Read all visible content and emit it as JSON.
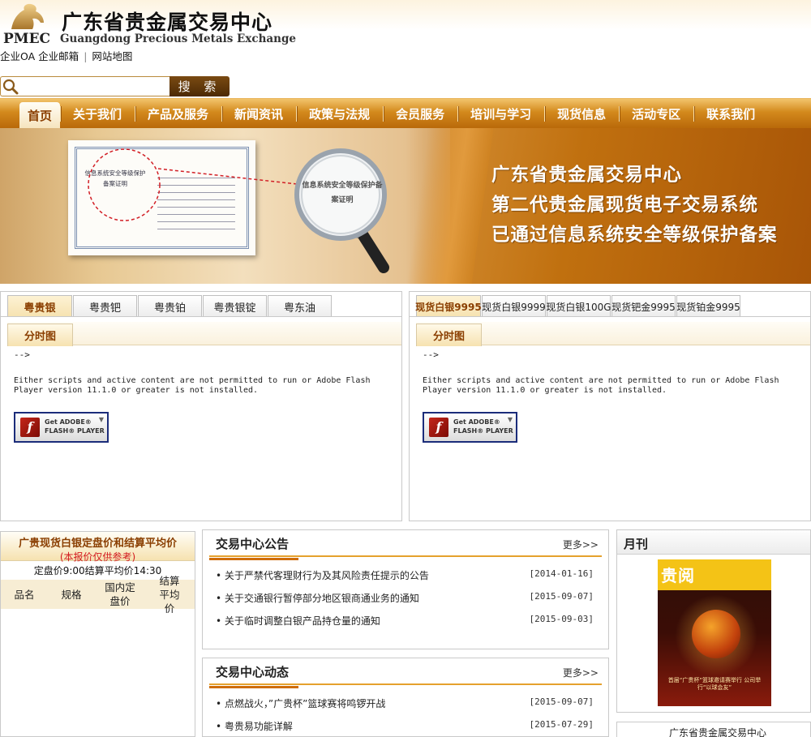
{
  "header": {
    "title_cn": "广东省贵金属交易中心",
    "title_en": "Guangdong Precious Metals Exchange",
    "logo_abbr": "PMEC",
    "links": [
      "企业OA",
      "企业邮箱",
      "网站地图"
    ]
  },
  "search": {
    "placeholder": "",
    "button_label": "搜 索"
  },
  "nav": {
    "items": [
      "首页",
      "关于我们",
      "产品及服务",
      "新闻资讯",
      "政策与法规",
      "会员服务",
      "培训与学习",
      "现货信息",
      "活动专区",
      "联系我们"
    ],
    "active": "首页"
  },
  "banner": {
    "line1": "广东省贵金属交易中心",
    "line2": "第二代贵金属现货电子交易系统",
    "line3": "已通过信息系统安全等级保护备案",
    "cert_title": "信息系统安全等级保护备案证明",
    "magnifier_text": "信息系统安全等级保护备案证明"
  },
  "quote_left": {
    "tabs": [
      "粤贵银",
      "粤贵钯",
      "粤贵铂",
      "粤贵银锭",
      "粤东油"
    ],
    "active_tab": "粤贵银",
    "subtab": "分时图",
    "arrow": "-->",
    "flash_message": "Either scripts and active content are not permitted to run or Adobe Flash Player version 11.1.0 or greater is not installed.",
    "flash_badge_line1": "Get ADOBE®",
    "flash_badge_line2": "FLASH® PLAYER"
  },
  "quote_right": {
    "tabs": [
      "现货白银9995",
      "现货白银9999",
      "现货白银100G",
      "现货钯金9995",
      "现货铂金9995"
    ],
    "active_tab": "现货白银9995",
    "subtab": "分时图",
    "arrow": "-->",
    "flash_message": "Either scripts and active content are not permitted to run or Adobe Flash Player version 11.1.0 or greater is not installed.",
    "flash_badge_line1": "Get ADOBE®",
    "flash_badge_line2": "FLASH® PLAYER"
  },
  "price_table": {
    "title": "广贵现货白银定盘价和结算平均价",
    "note": "(本报价仅供参考)",
    "time_text": "定盘价9:00结算平均价14:30",
    "columns": [
      "品名",
      "规格",
      "国内定盘价",
      "结算平均价"
    ]
  },
  "notice": {
    "title": "交易中心公告",
    "more": "更多>>",
    "items": [
      {
        "text": "• 关于严禁代客理财行为及其风险责任提示的公告",
        "date": "[2014-01-16]"
      },
      {
        "text": "• 关于交通银行暂停部分地区银商通业务的通知",
        "date": "[2015-09-07]"
      },
      {
        "text": "• 关于临时调整白银产品持仓量的通知",
        "date": "[2015-09-03]"
      }
    ]
  },
  "dynamic": {
    "title": "交易中心动态",
    "more": "更多>>",
    "items": [
      {
        "text": "• 点燃战火，”广贵杯”篮球赛将鸣锣开战",
        "date": "[2015-09-07]"
      },
      {
        "text": "• 粤贵易功能详解",
        "date": "[2015-07-29]"
      }
    ]
  },
  "monthly": {
    "title": "月刊",
    "magazine_name": "贵阅",
    "magazine_caption": "首届“广贵杯”篮球邀请赛举行 公司举行“以球会友”"
  },
  "footer_box": {
    "text": "广东省贵金属交易中心"
  }
}
